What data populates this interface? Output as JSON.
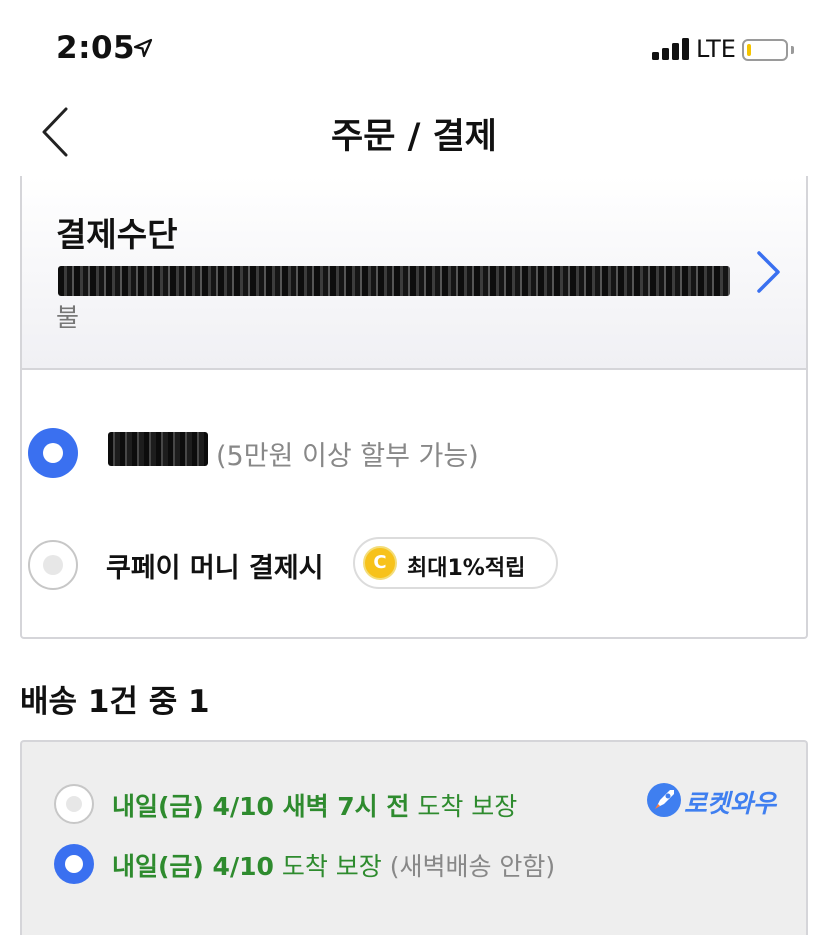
{
  "status_bar": {
    "time": "2:05",
    "carrier": "LTE",
    "icons": [
      "location-arrow-icon",
      "signal-icon",
      "battery-icon"
    ]
  },
  "nav": {
    "title": "주문 / 결제",
    "back_icon": "chevron-left-icon"
  },
  "payment": {
    "title": "결제수단",
    "subtitle": "불",
    "options": [
      {
        "label_suffix": "(5만원 이상 할부 가능)",
        "selected": true
      },
      {
        "label": "쿠페이 머니 결제시",
        "badge_coin": "C",
        "badge_text": "최대1%적립",
        "selected": false
      }
    ]
  },
  "shipping": {
    "heading": "배송 1건 중 1",
    "brand": "로켓와우",
    "options": [
      {
        "bold": "내일(금) 4/10 새벽 7시 전",
        "normal": " 도착 보장",
        "note": "",
        "selected": false
      },
      {
        "bold": "내일(금) 4/10",
        "normal": " 도착 보장",
        "note": " (새벽배송 안함)",
        "selected": true
      }
    ]
  },
  "colors": {
    "accent_blue": "#3a70f0",
    "green": "#2e8b2e",
    "coin": "#f7c21a"
  }
}
